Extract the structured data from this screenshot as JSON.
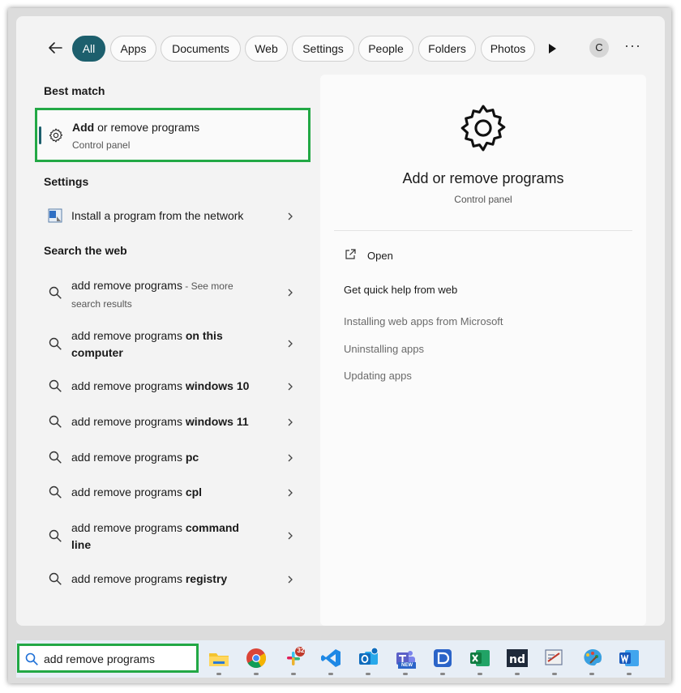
{
  "filters": {
    "tabs": [
      {
        "label": "All",
        "active": true
      },
      {
        "label": "Apps"
      },
      {
        "label": "Documents"
      },
      {
        "label": "Web"
      },
      {
        "label": "Settings"
      },
      {
        "label": "People"
      },
      {
        "label": "Folders"
      },
      {
        "label": "Photos"
      }
    ],
    "avatar_letter": "C",
    "more_label": "···"
  },
  "best_match": {
    "heading": "Best match",
    "title_bold": "Add",
    "title_rest": " or remove programs",
    "subtitle": "Control panel",
    "icon": "gear-icon"
  },
  "settings": {
    "heading": "Settings",
    "items": [
      {
        "label": "Install a program from the network",
        "icon": "install-program-icon"
      }
    ]
  },
  "web": {
    "heading": "Search the web",
    "items": [
      {
        "prefix": "add remove programs",
        "suffix": "",
        "see_more": " - See more",
        "second_line": "search results"
      },
      {
        "prefix": "add remove programs ",
        "suffix": "on this",
        "second_line_bold": "computer"
      },
      {
        "prefix": "add remove programs ",
        "suffix": "windows 10"
      },
      {
        "prefix": "add remove programs ",
        "suffix": "windows 11"
      },
      {
        "prefix": "add remove programs ",
        "suffix": "pc"
      },
      {
        "prefix": "add remove programs ",
        "suffix": "cpl"
      },
      {
        "prefix": "add remove programs ",
        "suffix": "command",
        "second_line_bold": "line"
      },
      {
        "prefix": "add remove programs ",
        "suffix": "registry"
      }
    ]
  },
  "detail": {
    "title": "Add or remove programs",
    "subtitle": "Control panel",
    "open_label": "Open",
    "help_heading": "Get quick help from web",
    "links": [
      "Installing web apps from Microsoft",
      "Uninstalling apps",
      "Updating apps"
    ]
  },
  "taskbar": {
    "search_value": "add remove programs",
    "apps": [
      {
        "name": "file-explorer-icon",
        "color": "#f4c430"
      },
      {
        "name": "chrome-icon",
        "color": "#db4437"
      },
      {
        "name": "slack-icon",
        "color": "#4a154b",
        "badge": "32"
      },
      {
        "name": "vscode-icon",
        "color": "#1e88e5"
      },
      {
        "name": "outlook-icon",
        "color": "#0f6cbd"
      },
      {
        "name": "teams-icon",
        "color": "#5b5fc7",
        "badge": "NEW"
      },
      {
        "name": "app-blue-icon",
        "color": "#2b64c8"
      },
      {
        "name": "excel-icon",
        "color": "#107c41"
      },
      {
        "name": "nd-icon",
        "color": "#1f2a3a"
      },
      {
        "name": "snipping-icon",
        "color": "#c0392b"
      },
      {
        "name": "paint-icon",
        "color": "#3aa0e0"
      },
      {
        "name": "word-icon",
        "color": "#185abd"
      }
    ]
  }
}
